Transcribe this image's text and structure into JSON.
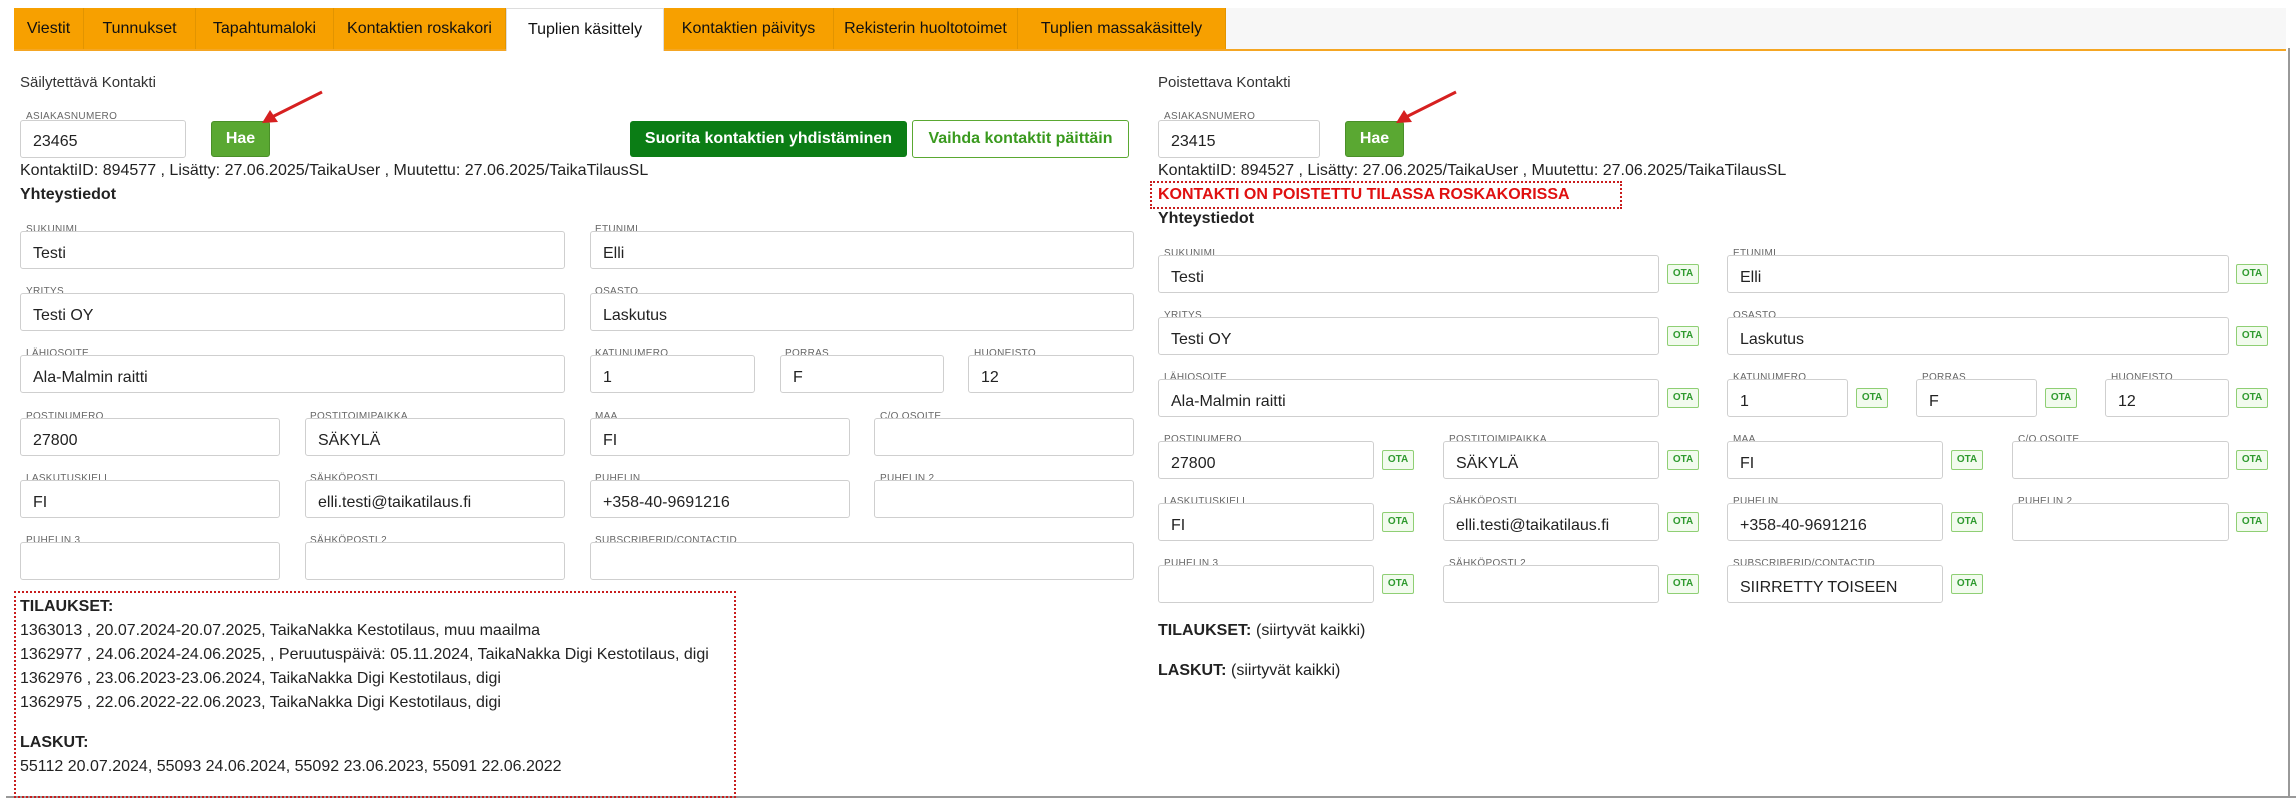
{
  "tabs": [
    "Viestit",
    "Tunnukset",
    "Tapahtumaloki",
    "Kontaktien roskakori",
    "Tuplien käsittely",
    "Kontaktien päivitys",
    "Rekisterin huoltotoimet",
    "Tuplien massakäsittely"
  ],
  "active_tab": "Tuplien käsittely",
  "ota_label": "OTA",
  "left": {
    "title": "Säilytettävä Kontakti",
    "asiakasnumero_label": "ASIAKASNUMERO",
    "asiakasnumero": "23465",
    "hae_label": "Hae",
    "merge_button": "Suorita kontaktien yhdistäminen",
    "swap_button": "Vaihda kontaktit päittäin",
    "meta": "KontaktiID: 894577 , Lisätty: 27.06.2025/TaikaUser , Muutettu: 27.06.2025/TaikaTilausSL",
    "yhteystiedot": "Yhteystiedot",
    "fields": {
      "sukunimi": {
        "label": "SUKUNIMI",
        "value": "Testi"
      },
      "etunimi": {
        "label": "ETUNIMI",
        "value": "Elli"
      },
      "yritys": {
        "label": "YRITYS",
        "value": "Testi OY"
      },
      "osasto": {
        "label": "OSASTO",
        "value": "Laskutus"
      },
      "lahiosoite": {
        "label": "LÄHIOSOITE",
        "value": "Ala-Malmin raitti"
      },
      "katunumero": {
        "label": "KATUNUMERO",
        "value": "1"
      },
      "porras": {
        "label": "PORRAS",
        "value": "F"
      },
      "huoneisto": {
        "label": "HUONEISTO",
        "value": "12"
      },
      "postinumero": {
        "label": "POSTINUMERO",
        "value": "27800"
      },
      "postitoimipaikka": {
        "label": "POSTITOIMIPAIKKA",
        "value": "SÄKYLÄ"
      },
      "maa": {
        "label": "MAA",
        "value": "FI"
      },
      "co_osoite": {
        "label": "C/O OSOITE",
        "value": ""
      },
      "laskutuskieli": {
        "label": "LASKUTUSKIELI",
        "value": "FI"
      },
      "sahkoposti": {
        "label": "SÄHKÖPOSTI",
        "value": "elli.testi@taikatilaus.fi"
      },
      "puhelin": {
        "label": "PUHELIN",
        "value": "+358-40-9691216"
      },
      "puhelin2": {
        "label": "PUHELIN 2",
        "value": ""
      },
      "puhelin3": {
        "label": "PUHELIN 3",
        "value": ""
      },
      "sahkoposti2": {
        "label": "SÄHKÖPOSTI 2",
        "value": ""
      },
      "subscriberid": {
        "label": "SUBSCRIBERID/CONTACTID",
        "value": ""
      }
    },
    "tilaukset_heading": "TILAUKSET:",
    "tilaukset": [
      "1363013 , 20.07.2024-20.07.2025, TaikaNakka Kestotilaus, muu maailma",
      "1362977 , 24.06.2024-24.06.2025, , Peruutuspäivä: 05.11.2024, TaikaNakka Digi Kestotilaus, digi",
      "1362976 , 23.06.2023-23.06.2024, TaikaNakka Digi Kestotilaus, digi",
      "1362975 , 22.06.2022-22.06.2023, TaikaNakka Digi Kestotilaus, digi"
    ],
    "laskut_heading": "LASKUT:",
    "laskut": "55112 20.07.2024, 55093 24.06.2024, 55092 23.06.2023, 55091 22.06.2022"
  },
  "right": {
    "title": "Poistettava Kontakti",
    "asiakasnumero_label": "ASIAKASNUMERO",
    "asiakasnumero": "23415",
    "hae_label": "Hae",
    "meta": "KontaktiID: 894527 , Lisätty: 27.06.2025/TaikaUser , Muutettu: 27.06.2025/TaikaTilausSL",
    "warning": "KONTAKTI ON POISTETTU TILASSA ROSKAKORISSA",
    "yhteystiedot": "Yhteystiedot",
    "fields": {
      "sukunimi": {
        "label": "SUKUNIMI",
        "value": "Testi"
      },
      "etunimi": {
        "label": "ETUNIMI",
        "value": "Elli"
      },
      "yritys": {
        "label": "YRITYS",
        "value": "Testi OY"
      },
      "osasto": {
        "label": "OSASTO",
        "value": "Laskutus"
      },
      "lahiosoite": {
        "label": "LÄHIOSOITE",
        "value": "Ala-Malmin raitti"
      },
      "katunumero": {
        "label": "KATUNUMERO",
        "value": "1"
      },
      "porras": {
        "label": "PORRAS",
        "value": "F"
      },
      "huoneisto": {
        "label": "HUONEISTO",
        "value": "12"
      },
      "postinumero": {
        "label": "POSTINUMERO",
        "value": "27800"
      },
      "postitoimipaikka": {
        "label": "POSTITOIMIPAIKKA",
        "value": "SÄKYLÄ"
      },
      "maa": {
        "label": "MAA",
        "value": "FI"
      },
      "co_osoite": {
        "label": "C/O OSOITE",
        "value": ""
      },
      "laskutuskieli": {
        "label": "LASKUTUSKIELI",
        "value": "FI"
      },
      "sahkoposti": {
        "label": "SÄHKÖPOSTI",
        "value": "elli.testi@taikatilaus.fi"
      },
      "puhelin": {
        "label": "PUHELIN",
        "value": "+358-40-9691216"
      },
      "puhelin2": {
        "label": "PUHELIN 2",
        "value": ""
      },
      "puhelin3": {
        "label": "PUHELIN 3",
        "value": ""
      },
      "sahkoposti2": {
        "label": "SÄHKÖPOSTI 2",
        "value": ""
      },
      "subscriberid": {
        "label": "SUBSCRIBERID/CONTACTID",
        "value": "SIIRRETTY TOISEEN"
      }
    },
    "tilaukset_heading": "TILAUKSET:",
    "tilaukset_note": "(siirtyvät kaikki)",
    "laskut_heading": "LASKUT:",
    "laskut_note": "(siirtyvät kaikki)"
  },
  "colors": {
    "tab_bg": "#f7a000",
    "green": "#5aa832",
    "dark_green": "#0b7d15",
    "warning": "#e01010"
  }
}
